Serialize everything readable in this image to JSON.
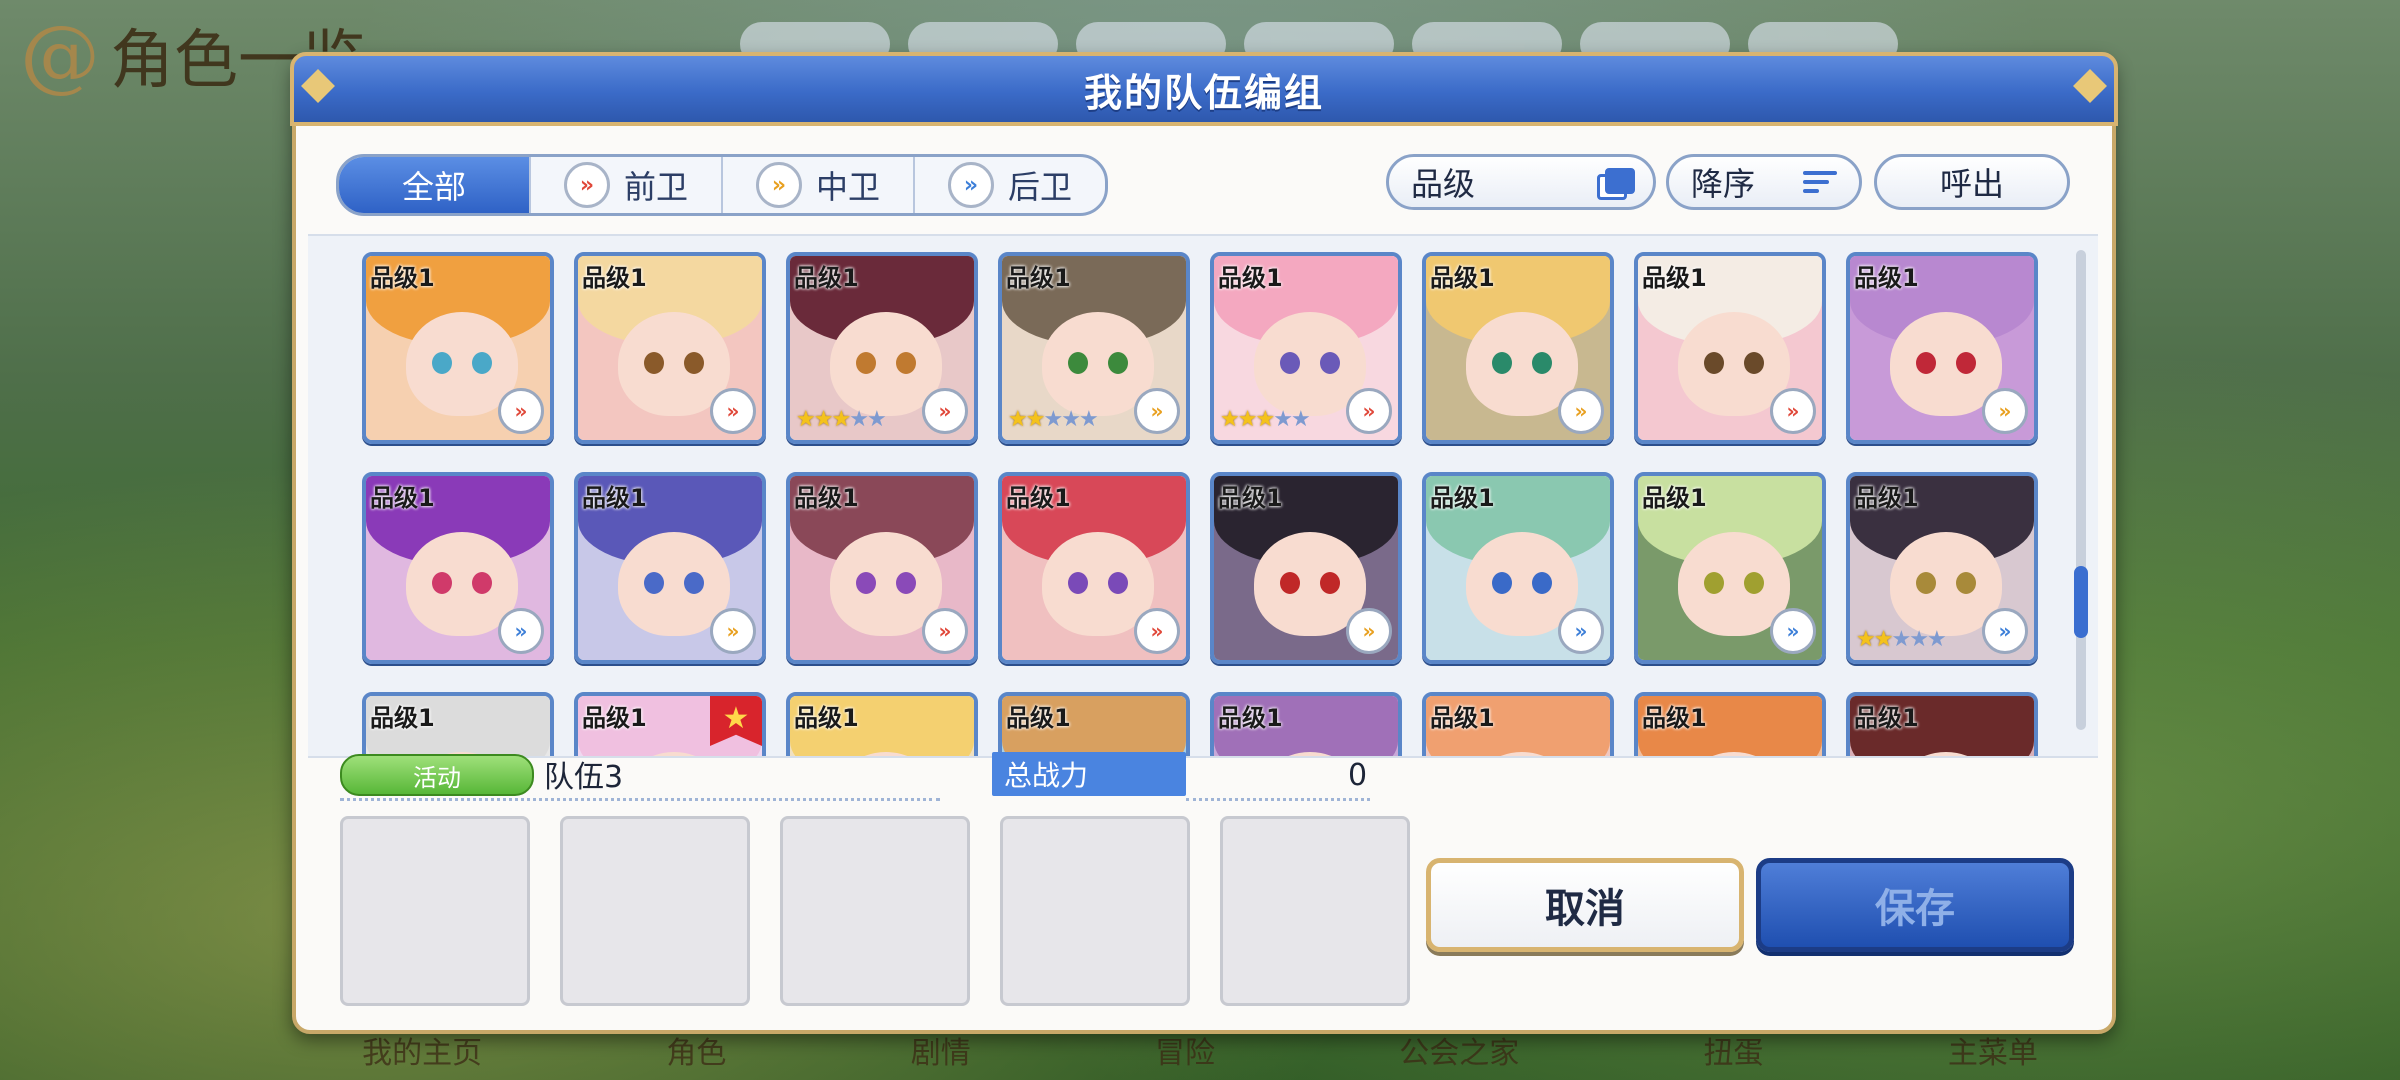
{
  "background": {
    "screen_title": "角色一览",
    "nav_items": [
      "我的主页",
      "角色",
      "剧情",
      "冒险",
      "公会之家",
      "扭蛋",
      "主菜单"
    ]
  },
  "dialog": {
    "title": "我的队伍编组",
    "filter_tabs": [
      {
        "label": "全部",
        "icon": "",
        "active": true
      },
      {
        "label": "前卫",
        "icon": "front-role-icon",
        "active": false
      },
      {
        "label": "中卫",
        "icon": "middle-role-icon",
        "active": false
      },
      {
        "label": "后卫",
        "icon": "back-role-icon",
        "active": false
      }
    ],
    "sort_key": "品级",
    "sort_order": "降序",
    "call_label": "呼出",
    "grade_label": "品级1",
    "characters": [
      {
        "role": "front",
        "stars": 0,
        "hair": "#f0a040",
        "eye": "#4aa8c8",
        "bg": "#f6d0b0"
      },
      {
        "role": "front",
        "stars": 0,
        "hair": "#f4d8a0",
        "eye": "#8a5a2a",
        "bg": "#f3c6c0"
      },
      {
        "role": "front",
        "stars": 3,
        "hair": "#6a2a3a",
        "eye": "#c07a30",
        "bg": "#e8c8c8"
      },
      {
        "role": "mid",
        "stars": 2,
        "hair": "#7a6a58",
        "eye": "#3c8a3c",
        "bg": "#e8d8c8"
      },
      {
        "role": "front",
        "stars": 3,
        "hair": "#f4a8c0",
        "eye": "#6a5ab8",
        "bg": "#f8d8e0"
      },
      {
        "role": "mid",
        "stars": 0,
        "hair": "#f0c870",
        "eye": "#2a8a6a",
        "bg": "#c8b890"
      },
      {
        "role": "front",
        "stars": 0,
        "hair": "#f4ece4",
        "eye": "#6a4a2a",
        "bg": "#f4c8d0"
      },
      {
        "role": "mid",
        "stars": 0,
        "hair": "#b888d0",
        "eye": "#c02838",
        "bg": "#c89ad8"
      },
      {
        "role": "back",
        "stars": 0,
        "hair": "#8a3ab8",
        "eye": "#d03a6a",
        "bg": "#e0b8e0"
      },
      {
        "role": "mid",
        "stars": 0,
        "hair": "#5a58b8",
        "eye": "#4a6ac8",
        "bg": "#c8c8e8"
      },
      {
        "role": "front",
        "stars": 0,
        "hair": "#8a4858",
        "eye": "#8a4ab8",
        "bg": "#e8b8c8"
      },
      {
        "role": "front",
        "stars": 0,
        "hair": "#d84858",
        "eye": "#7a4ab8",
        "bg": "#f0c0c0"
      },
      {
        "role": "mid",
        "stars": 0,
        "hair": "#2a2430",
        "eye": "#c02828",
        "bg": "#7a6a8a"
      },
      {
        "role": "back",
        "stars": 0,
        "hair": "#8ac8b0",
        "eye": "#3a6ac8",
        "bg": "#c8e0e8"
      },
      {
        "role": "back",
        "stars": 0,
        "hair": "#c8e0a0",
        "eye": "#a0a030",
        "bg": "#7a9a6a"
      },
      {
        "role": "back",
        "stars": 2,
        "hair": "#3a3040",
        "eye": "#a88a3a",
        "bg": "#d8c8d0"
      },
      {
        "role": "front",
        "stars": 0,
        "hair": "#dcdcdc",
        "eye": "#6a6a6a",
        "bg": "#e8e8e8"
      },
      {
        "role": "front",
        "stars": 0,
        "hair": "#f0c0e0",
        "eye": "#8a5ab8",
        "bg": "#f0d8f0",
        "ribbon": true
      },
      {
        "role": "front",
        "stars": 0,
        "hair": "#f4d070",
        "eye": "#6a8ab8",
        "bg": "#f0e0c0"
      },
      {
        "role": "front",
        "stars": 0,
        "hair": "#d8a060",
        "eye": "#4a6ac8",
        "bg": "#a8d0e8"
      },
      {
        "role": "front",
        "stars": 0,
        "hair": "#a070b8",
        "eye": "#6a3a8a",
        "bg": "#c8a8d8"
      },
      {
        "role": "front",
        "stars": 0,
        "hair": "#f0a070",
        "eye": "#c03040",
        "bg": "#f0c8c0"
      },
      {
        "role": "front",
        "stars": 0,
        "hair": "#e88848",
        "eye": "#6a3a2a",
        "bg": "#f0c0a0"
      },
      {
        "role": "front",
        "stars": 0,
        "hair": "#6a2a2a",
        "eye": "#a03030",
        "bg": "#d8b0b8"
      }
    ],
    "team": {
      "event_badge": "活动",
      "name": "队伍3",
      "power_label": "总战力",
      "power_value": "0",
      "slots": 5
    },
    "buttons": {
      "cancel": "取消",
      "save": "保存"
    }
  },
  "colors": {
    "front": "#e0483a",
    "mid": "#e8a020",
    "back": "#3d7fd8",
    "header_blue": "#3b6bc8",
    "gold_border": "#d8b470"
  }
}
